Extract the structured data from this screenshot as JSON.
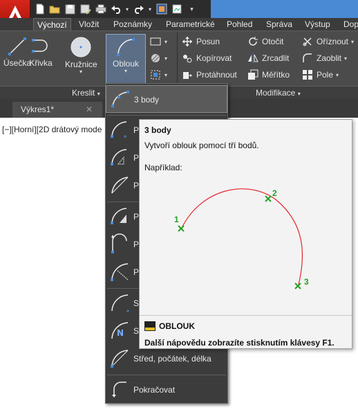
{
  "qat": {
    "icons": [
      "new-icon",
      "open-icon",
      "save-icon",
      "save-as-icon",
      "print-icon",
      "undo-icon",
      "redo-icon",
      "workspace-icon",
      "dropdown-icon"
    ]
  },
  "tabs": [
    {
      "label": "Výchozí",
      "active": true
    },
    {
      "label": "Vložit"
    },
    {
      "label": "Poznámky"
    },
    {
      "label": "Parametrické"
    },
    {
      "label": "Pohled"
    },
    {
      "label": "Správa"
    },
    {
      "label": "Výstup"
    },
    {
      "label": "Dop"
    }
  ],
  "draw_panel": {
    "label": "Kreslit",
    "line": "Úsečka",
    "polyline": "Křivka",
    "circle": "Kružnice",
    "arc": "Oblouk"
  },
  "modify_panel": {
    "label": "Modifikace",
    "move": "Posun",
    "copy": "Kopírovat",
    "stretch": "Protáhnout",
    "rotate": "Otočit",
    "mirror": "Zrcadlit",
    "scale": "Měřítko",
    "trim": "Oříznout",
    "fillet": "Zaoblit",
    "array": "Pole"
  },
  "document": {
    "tab": "Výkres1*",
    "close": "✕",
    "viewport": "[−][Horní][2D drátový mode"
  },
  "arc_menu": {
    "items": [
      {
        "label": "3 body",
        "selected": true
      },
      {
        "label": "P"
      },
      {
        "label": "P"
      },
      {
        "label": "P"
      },
      {
        "label": "P"
      },
      {
        "label": "P"
      },
      {
        "label": "P"
      },
      {
        "label": "St"
      },
      {
        "label": "St"
      },
      {
        "label": "Střed, počátek, délka"
      },
      {
        "label": "Pokračovat"
      }
    ]
  },
  "tooltip": {
    "title": "3 body",
    "description": "Vytvoří oblouk pomocí tří bodů.",
    "example_label": "Například:",
    "points": [
      "1",
      "2",
      "3"
    ],
    "command": "OBLOUK",
    "help": "Další nápovědu zobrazíte stisknutím klávesy F1."
  },
  "colors": {
    "accent": "#4a8ad4",
    "arc": "#e8242a",
    "points": "#22a022",
    "app": "#c8201a"
  }
}
